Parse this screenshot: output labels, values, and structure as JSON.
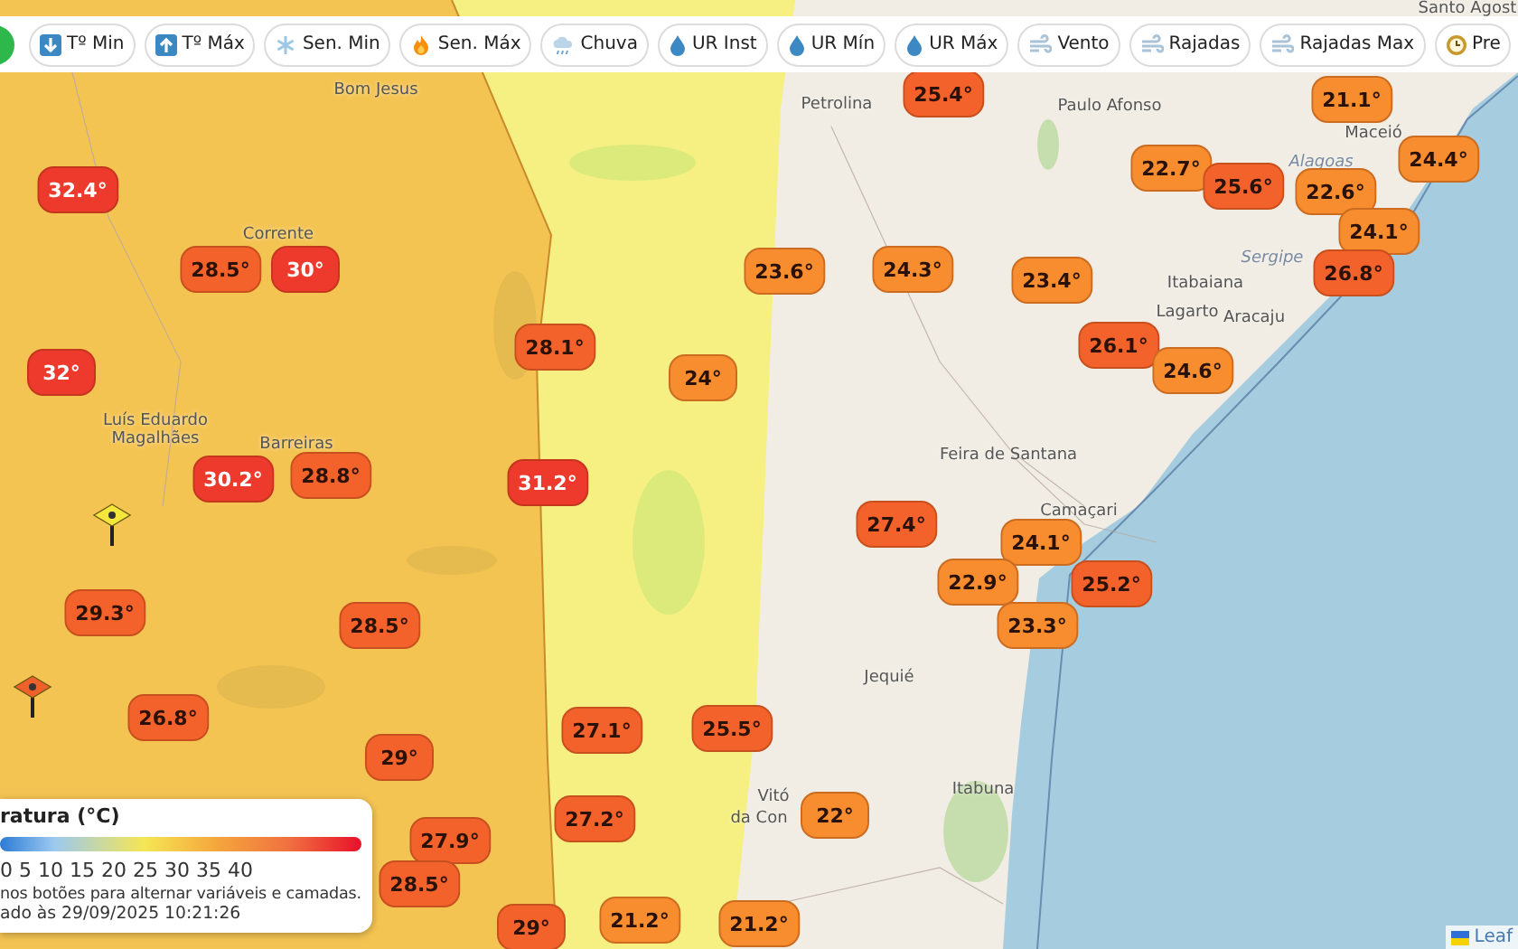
{
  "toolbar": {
    "buttons": [
      {
        "label": "Tº Min"
      },
      {
        "label": "Tº Máx"
      },
      {
        "label": "Sen. Min"
      },
      {
        "label": "Sen. Máx"
      },
      {
        "label": "Chuva"
      },
      {
        "label": "UR Inst"
      },
      {
        "label": "UR Mín"
      },
      {
        "label": "UR Máx"
      },
      {
        "label": "Vento"
      },
      {
        "label": "Rajadas"
      },
      {
        "label": "Rajadas Max"
      },
      {
        "label": "Pre"
      }
    ]
  },
  "map": {
    "places": [
      {
        "name": "Bom Jesus",
        "kind": "city"
      },
      {
        "name": "Corrente",
        "kind": "city"
      },
      {
        "name": "Luís Eduardo",
        "kind": "city"
      },
      {
        "name": "Magalhães",
        "kind": "city"
      },
      {
        "name": "Barreiras",
        "kind": "city"
      },
      {
        "name": "Petrolina",
        "kind": "city"
      },
      {
        "name": "Paulo Afonso",
        "kind": "city"
      },
      {
        "name": "Alagoas",
        "kind": "state"
      },
      {
        "name": "Maceió",
        "kind": "city"
      },
      {
        "name": "Sergipe",
        "kind": "state"
      },
      {
        "name": "Itabaiana",
        "kind": "city"
      },
      {
        "name": "Lagarto",
        "kind": "city"
      },
      {
        "name": "Aracaju",
        "kind": "city"
      },
      {
        "name": "Feira de Santana",
        "kind": "city"
      },
      {
        "name": "Camaçari",
        "kind": "city"
      },
      {
        "name": "Jequié",
        "kind": "city"
      },
      {
        "name": "Itabuna",
        "kind": "city"
      },
      {
        "name": "Vitó",
        "kind": "city"
      },
      {
        "name": "da Con",
        "kind": "city"
      },
      {
        "name": "Santo Agost",
        "kind": "city"
      }
    ],
    "markers": [
      {
        "reading": "32.4°",
        "color": "#ee3a2c"
      },
      {
        "reading": "28.5°",
        "color": "#f3622b"
      },
      {
        "reading": "30°",
        "color": "#ee3a2c"
      },
      {
        "reading": "32°",
        "color": "#ee3a2c"
      },
      {
        "reading": "28.1°",
        "color": "#f3622b"
      },
      {
        "reading": "24°",
        "color": "#f88d2f"
      },
      {
        "reading": "23.6°",
        "color": "#f88d2f"
      },
      {
        "reading": "24.3°",
        "color": "#f88d2f"
      },
      {
        "reading": "25.4°",
        "color": "#f3622b"
      },
      {
        "reading": "23.4°",
        "color": "#f88d2f"
      },
      {
        "reading": "22.7°",
        "color": "#f88d2f"
      },
      {
        "reading": "25.6°",
        "color": "#f3622b"
      },
      {
        "reading": "21.1°",
        "color": "#f88d2f"
      },
      {
        "reading": "22.6°",
        "color": "#f88d2f"
      },
      {
        "reading": "24.4°",
        "color": "#f88d2f"
      },
      {
        "reading": "24.1°",
        "color": "#f88d2f"
      },
      {
        "reading": "26.8°",
        "color": "#f3622b"
      },
      {
        "reading": "26.1°",
        "color": "#f3622b"
      },
      {
        "reading": "24.6°",
        "color": "#f88d2f"
      },
      {
        "reading": "30.2°",
        "color": "#ee3a2c"
      },
      {
        "reading": "28.8°",
        "color": "#f3622b"
      },
      {
        "reading": "31.2°",
        "color": "#ee3a2c"
      },
      {
        "reading": "29.3°",
        "color": "#f3622b"
      },
      {
        "reading": "28.5°",
        "color": "#f3622b"
      },
      {
        "reading": "26.8°",
        "color": "#f3622b"
      },
      {
        "reading": "29°",
        "color": "#f3622b"
      },
      {
        "reading": "27.1°",
        "color": "#f3622b"
      },
      {
        "reading": "25.5°",
        "color": "#f3622b"
      },
      {
        "reading": "27.4°",
        "color": "#f3622b"
      },
      {
        "reading": "24.1°",
        "color": "#f88d2f"
      },
      {
        "reading": "25.2°",
        "color": "#f3622b"
      },
      {
        "reading": "22.9°",
        "color": "#f88d2f"
      },
      {
        "reading": "23.3°",
        "color": "#f88d2f"
      },
      {
        "reading": "22°",
        "color": "#f88d2f"
      },
      {
        "reading": "27.2°",
        "color": "#f3622b"
      },
      {
        "reading": "27.9°",
        "color": "#f3622b"
      },
      {
        "reading": "28.5°",
        "color": "#f3622b"
      },
      {
        "reading": "29°",
        "color": "#f3622b"
      },
      {
        "reading": "21.2°",
        "color": "#f88d2f"
      },
      {
        "reading": "21.2°",
        "color": "#f88d2f"
      }
    ],
    "warnings": [
      {
        "color": "#f5e63c"
      },
      {
        "color": "#f0602a"
      }
    ]
  },
  "legend": {
    "title": "ratura (°C)",
    "scale": "0 5 10 15 20 25 30 35 40",
    "hint": "nos botões para alternar variáveis e camadas.",
    "updated": "ado às 29/09/2025 10:21:26"
  },
  "attribution": {
    "text": "Leaf"
  }
}
